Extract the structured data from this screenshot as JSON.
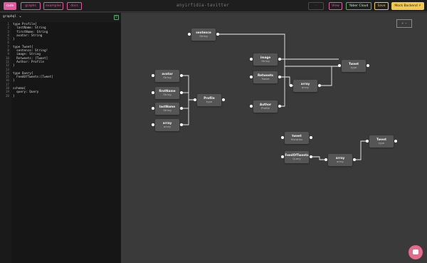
{
  "nav": {
    "items": [
      {
        "label": "code",
        "active": true
      },
      {
        "label": "graphs",
        "active": false
      },
      {
        "label": "examples",
        "active": false
      },
      {
        "label": "docs",
        "active": false
      }
    ]
  },
  "app_title": "anyirfidia-tavitter",
  "actions": {
    "disabled_label": "···",
    "view_label": "View",
    "yaber_cloud_label": "Yaber Cloud",
    "save_label": "Save",
    "mock_backend_label": "Mock Backend"
  },
  "editor": {
    "language": "graphql",
    "lines": [
      "type Profile{",
      "  lastName: String",
      "  firstName: String",
      "  avatar: String",
      "}",
      "",
      "type Tweet{",
      "  sentence: String!",
      "  image: String",
      "  Retweets: [Tweet]",
      "  Author: Profile",
      "}",
      "",
      "type Query{",
      "  FeedOfTweets:[Tweet]",
      "}",
      "",
      "schema{",
      "  query: Query",
      "}"
    ]
  },
  "canvas": {
    "minimap_label": "+ −",
    "nodes": [
      {
        "id": "sentence",
        "name": "sentence",
        "type": "String"
      },
      {
        "id": "image",
        "name": "image",
        "type": "String"
      },
      {
        "id": "retweets",
        "name": "Retweets",
        "type": "Tweet"
      },
      {
        "id": "author",
        "name": "Author",
        "type": "Profile"
      },
      {
        "id": "array1",
        "name": "array",
        "type": "array"
      },
      {
        "id": "tweet1",
        "name": "Tweet",
        "type": "type"
      },
      {
        "id": "avatar",
        "name": "avatar",
        "type": "String"
      },
      {
        "id": "firstname",
        "name": "firstName",
        "type": "String"
      },
      {
        "id": "lastname",
        "name": "lastName",
        "type": "String"
      },
      {
        "id": "array2",
        "name": "array",
        "type": "array"
      },
      {
        "id": "profile",
        "name": "Profile",
        "type": "type"
      },
      {
        "id": "tweetmut",
        "name": "tweet",
        "type": "Mutation"
      },
      {
        "id": "feed",
        "name": "FeedOfTweets",
        "type": "Query"
      },
      {
        "id": "array3",
        "name": "array",
        "type": "array"
      },
      {
        "id": "tweet2",
        "name": "Tweet",
        "type": "type"
      }
    ]
  },
  "colors": {
    "accent_pink": "#e05aa0",
    "accent_green": "#4fb06a",
    "accent_yellow": "#f2c94c",
    "chat_bubble": "#e66a8c"
  },
  "icons": {
    "chat": "chat-icon",
    "mock_backend": "lightning-icon",
    "chevron": "chevron-down-icon"
  }
}
